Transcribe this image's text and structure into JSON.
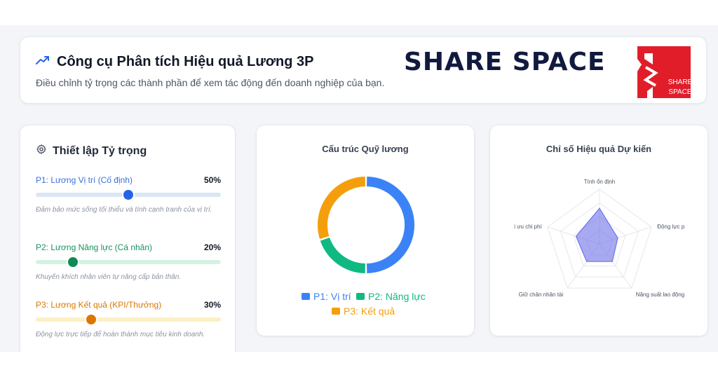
{
  "header": {
    "title": "Công cụ Phân tích Hiệu quả Lương 3P",
    "subtitle": "Điều chỉnh tỷ trọng các thành phần để xem tác động đến doanh nghiệp của bạn.",
    "brand_text": "SHARE SPACE",
    "logo_text_line1": "SHARE",
    "logo_text_line2": "SPACE",
    "trend_icon": "trending-up-icon"
  },
  "settings": {
    "title": "Thiết lập Tỷ trọng",
    "icon": "gear-icon",
    "params": [
      {
        "label": "P1: Lương Vị trí (Cố định)",
        "value_text": "50%",
        "value": 50,
        "description": "Đảm bảo mức sống tối thiểu và tính cạnh tranh của vị trí.",
        "color": "#3b6fe0",
        "track_color": "#dbe6f6",
        "thumb_color": "#2563eb"
      },
      {
        "label": "P2: Lương Năng lực (Cá nhân)",
        "value_text": "20%",
        "value": 20,
        "description": "Khuyến khích nhân viên tự nâng cấp bản thân.",
        "color": "#17935f",
        "track_color": "#d3f3e2",
        "thumb_color": "#0e8a57"
      },
      {
        "label": "P3: Lương Kết quả (KPI/Thưởng)",
        "value_text": "30%",
        "value": 30,
        "description": "Động lực trực tiếp để hoàn thành mục tiêu kinh doanh.",
        "color": "#d97706",
        "track_color": "#fcf0c4",
        "thumb_color": "#d97706"
      }
    ]
  },
  "chart_data": [
    {
      "type": "pie",
      "title": "Cấu trúc Quỹ lương",
      "categories": [
        "P1: Vị trí",
        "P2: Năng lực",
        "P3: Kết quả"
      ],
      "values": [
        50,
        20,
        30
      ],
      "colors": [
        "#3b82f6",
        "#10b981",
        "#f59e0b"
      ],
      "legend": "bottom"
    },
    {
      "type": "radar",
      "title": "Chỉ số Hiệu quả Dự kiến",
      "categories": [
        "Tính ổn định",
        "Động lực p",
        "Năng suất lao động",
        "Giữ chân nhân tài",
        "i ưu chi phí"
      ],
      "values": [
        65,
        35,
        40,
        40,
        45
      ],
      "range": [
        0,
        100
      ],
      "fill_color": "#6d72e8"
    }
  ]
}
